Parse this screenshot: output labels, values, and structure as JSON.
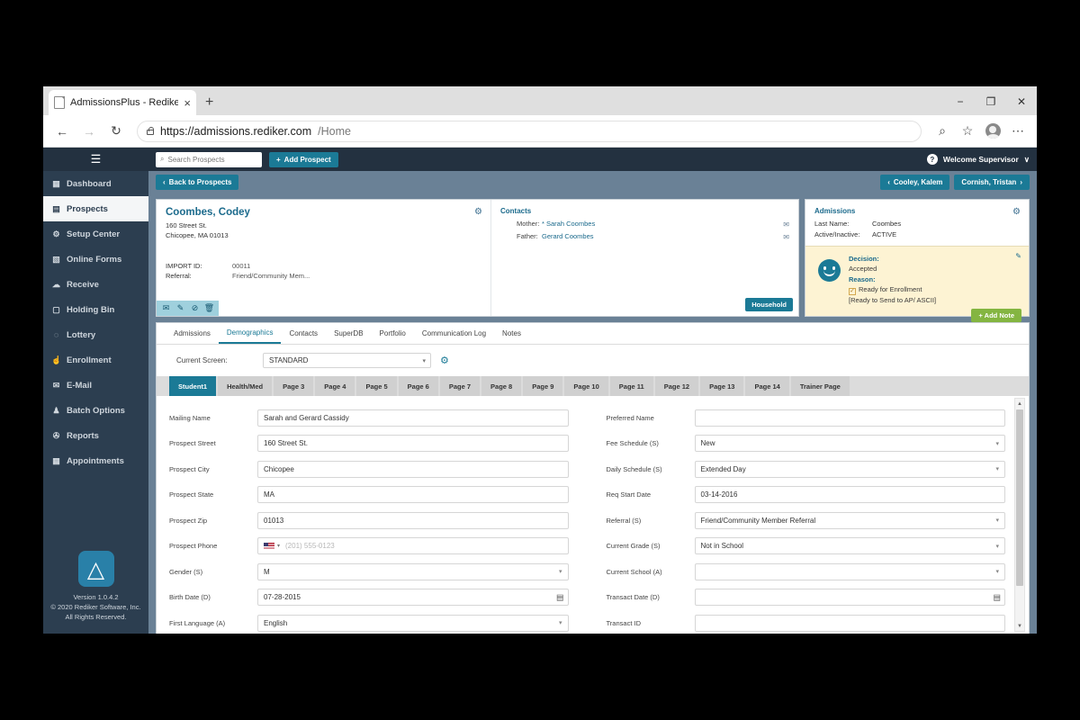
{
  "browser": {
    "tab_title": "AdmissionsPlus - Rediker Softwa",
    "tab_close": "×",
    "new_tab": "+",
    "minimize": "−",
    "maximize": "❐",
    "close": "✕",
    "back": "←",
    "forward": "→",
    "reload": "↻",
    "url_strong": "https://admissions.rediker.com",
    "url_dim": "/Home",
    "zoom_icon": "⌕",
    "favorite_icon": "☆",
    "menu_icon": "⋯"
  },
  "sidebar": {
    "hamburger": "☰",
    "items": [
      {
        "label": "Dashboard",
        "icon": "▦",
        "active": false
      },
      {
        "label": "Prospects",
        "icon": "▤",
        "active": true
      },
      {
        "label": "Setup Center",
        "icon": "⚙",
        "active": false
      },
      {
        "label": "Online Forms",
        "icon": "▧",
        "active": false
      },
      {
        "label": "Receive",
        "icon": "☁",
        "active": false
      },
      {
        "label": "Holding Bin",
        "icon": "▢",
        "active": false
      },
      {
        "label": "Lottery",
        "icon": "◌",
        "active": false
      },
      {
        "label": "Enrollment",
        "icon": "☝",
        "active": false
      },
      {
        "label": "E-Mail",
        "icon": "✉",
        "active": false
      },
      {
        "label": "Batch Options",
        "icon": "♟",
        "active": false
      },
      {
        "label": "Reports",
        "icon": "✇",
        "active": false
      },
      {
        "label": "Appointments",
        "icon": "▦",
        "active": false
      }
    ],
    "logo_glyph": "⥣",
    "version": "Version 1.0.4.2",
    "copyright": "© 2020 Rediker Software, Inc.",
    "rights": "All Rights Reserved."
  },
  "topbar": {
    "search_placeholder": "Search Prospects",
    "search_value": "",
    "search_icon": "⌕",
    "add_prospect_label": "Add Prospect",
    "add_prospect_plus": "+",
    "help_icon": "?",
    "welcome_label": "Welcome Supervisor",
    "welcome_caret": "∨"
  },
  "subbar": {
    "back_label": "Back to Prospects",
    "back_caret": "‹",
    "prev_label": "Cooley, Kalem",
    "prev_caret": "‹",
    "next_label": "Cornish, Tristan",
    "next_caret": "›"
  },
  "prospect": {
    "name": "Coombes, Codey",
    "street": "160 Street St.",
    "citystate": "Chicopee, MA 01013",
    "import_id_label": "IMPORT ID:",
    "import_id_value": "00011",
    "referral_label": "Referral:",
    "referral_value": "Friend/Community Mem...",
    "gear_icon": "⚙",
    "actions": [
      "✉",
      "✎",
      "⊘",
      "Ὕ1"
    ]
  },
  "contacts": {
    "heading": "Contacts",
    "rows": [
      {
        "role": "Mother:",
        "name": "* Sarah Coombes",
        "mail_icon": "✉"
      },
      {
        "role": "Father:",
        "name": "Gerard Coombes",
        "mail_icon": "✉"
      }
    ],
    "household_label": "Household"
  },
  "admissions": {
    "heading": "Admissions",
    "gear_icon": "⚙",
    "rows": [
      {
        "key": "Last Name:",
        "value": "Coombes"
      },
      {
        "key": "Active/Inactive:",
        "value": "ACTIVE"
      }
    ],
    "decision_label": "Decision:",
    "decision_value": "Accepted",
    "reason_label": "Reason:",
    "reason_value": "Ready for Enrollment",
    "reason_note": "[Ready to Send to AP/ ASCII]",
    "checkbox_glyph": "✓",
    "edit_icon": "✎"
  },
  "tabs": {
    "items": [
      {
        "label": "Admissions",
        "active": false
      },
      {
        "label": "Demographics",
        "active": true
      },
      {
        "label": "Contacts",
        "active": false
      },
      {
        "label": "SuperDB",
        "active": false
      },
      {
        "label": "Portfolio",
        "active": false
      },
      {
        "label": "Communication Log",
        "active": false
      },
      {
        "label": "Notes",
        "active": false
      }
    ],
    "add_note_label": "Add Note",
    "add_note_plus": "+"
  },
  "screen_selector": {
    "label": "Current Screen:",
    "value": "STANDARD",
    "gear_icon": "⚙"
  },
  "page_tabs": [
    {
      "label": "Student1",
      "active": true
    },
    {
      "label": "Health/Med",
      "active": false
    },
    {
      "label": "Page 3",
      "active": false
    },
    {
      "label": "Page 4",
      "active": false
    },
    {
      "label": "Page 5",
      "active": false
    },
    {
      "label": "Page 6",
      "active": false
    },
    {
      "label": "Page 7",
      "active": false
    },
    {
      "label": "Page 8",
      "active": false
    },
    {
      "label": "Page 9",
      "active": false
    },
    {
      "label": "Page 10",
      "active": false
    },
    {
      "label": "Page 11",
      "active": false
    },
    {
      "label": "Page 12",
      "active": false
    },
    {
      "label": "Page 13",
      "active": false
    },
    {
      "label": "Page 14",
      "active": false
    },
    {
      "label": "Trainer Page",
      "active": false
    }
  ],
  "form": {
    "left": [
      {
        "label": "Mailing Name",
        "value": "Sarah and Gerard Cassidy",
        "type": "text"
      },
      {
        "label": "Prospect Street",
        "value": "160 Street St.",
        "type": "text"
      },
      {
        "label": "Prospect City",
        "value": "Chicopee",
        "type": "text"
      },
      {
        "label": "Prospect State",
        "value": "MA",
        "type": "text"
      },
      {
        "label": "Prospect Zip",
        "value": "01013",
        "type": "text"
      },
      {
        "label": "Prospect Phone",
        "value": "",
        "placeholder": "(201) 555-0123",
        "type": "phone"
      },
      {
        "label": "Gender (S)",
        "value": "M",
        "type": "select"
      },
      {
        "label": "Birth Date (D)",
        "value": "07-28-2015",
        "type": "date"
      },
      {
        "label": "First Language (A)",
        "value": "English",
        "type": "select"
      },
      {
        "label": "",
        "value": "",
        "type": "text"
      }
    ],
    "right": [
      {
        "label": "Preferred Name",
        "value": "",
        "type": "text"
      },
      {
        "label": "Fee Schedule (S)",
        "value": "New",
        "type": "select"
      },
      {
        "label": "Daily Schedule (S)",
        "value": "Extended Day",
        "type": "select"
      },
      {
        "label": "Req Start Date",
        "value": "03-14-2016",
        "type": "text"
      },
      {
        "label": "Referral (S)",
        "value": "Friend/Community Member Referral",
        "type": "select"
      },
      {
        "label": "Current Grade (S)",
        "value": "Not in School",
        "type": "select"
      },
      {
        "label": "Current School (A)",
        "value": "",
        "type": "select"
      },
      {
        "label": "Transact Date (D)",
        "value": "",
        "type": "date"
      },
      {
        "label": "Transact ID",
        "value": "",
        "type": "text"
      },
      {
        "label": "",
        "value": "",
        "type": "text"
      }
    ]
  },
  "scrollbar": {
    "up": "▲",
    "down": "▼"
  }
}
